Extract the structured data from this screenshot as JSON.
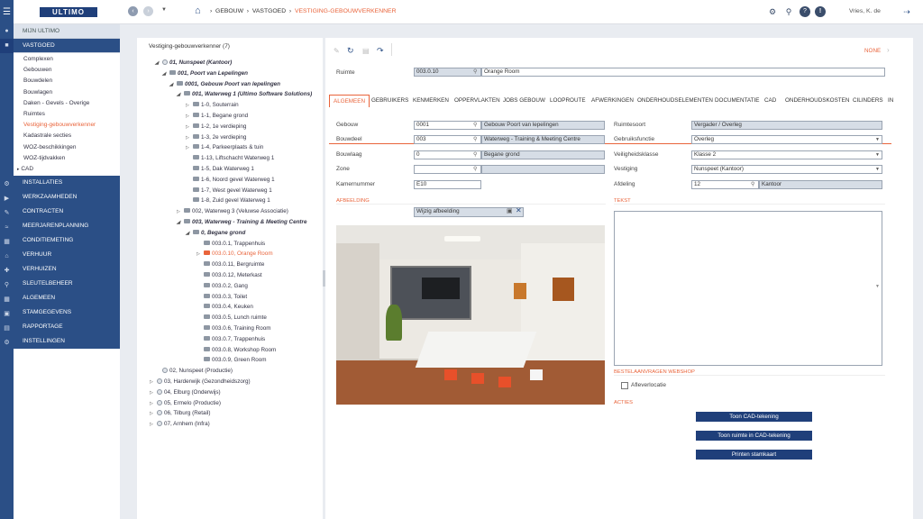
{
  "app": {
    "logo": "ULTIMO",
    "user": "Vries, K. de"
  },
  "breadcrumb": [
    "GEBOUW",
    "VASTGOED",
    "VESTIGING-GEBOUWVERKENNER"
  ],
  "nav": {
    "mijn": "MIJN ULTIMO",
    "vastgoed": "VASTGOED",
    "sub": [
      "Complexen",
      "Gebouwen",
      "Bouwdelen",
      "Bouwlagen",
      "Daken - Gevels - Overige",
      "Ruimtes",
      "Vestiging-gebouwverkenner",
      "Kadastrale secties",
      "WOZ-beschikkingen",
      "WOZ-tijdvakken",
      "CAD"
    ],
    "sections": [
      "INSTALLATIES",
      "WERKZAAMHEDEN",
      "CONTRACTEN",
      "MEERJARENPLANNING",
      "CONDITIEMETING",
      "VERHUUR",
      "VERHUIZEN",
      "SLEUTELBEHEER",
      "ALGEMEEN",
      "STAMGEGEVENS",
      "RAPPORTAGE",
      "INSTELLINGEN"
    ]
  },
  "tree": {
    "title": "Vestiging-gebouwverkenner (7)",
    "rows": [
      "01, Nunspeet (Kantoor)",
      "001, Poort van Lepelingen",
      "0001, Gebouw Poort van lepelingen",
      "001, Waterweg 1 (Ultimo Software Solutions)",
      "1-0, Souterrain",
      "1-1, Begane grond",
      "1-2, 1e verdieping",
      "1-3, 2e verdieping",
      "1-4, Parkeerplaats & tuin",
      "1-13, Liftschacht Waterweg 1",
      "1-5, Dak Waterweg 1",
      "1-6, Noord gevel Waterweg 1",
      "1-7, West gevel Waterweg 1",
      "1-8, Zuid gevel Waterweg 1",
      "002, Waterweg 3 (Veluwse Associatie)",
      "003, Waterweg - Training & Meeting Centre",
      "0, Begane grond",
      "003.0.1, Trappenhuis",
      "003.0.10, Orange Room",
      "003.0.11, Bergruimte",
      "003.0.12, Meterkast",
      "003.0.2, Gang",
      "003.0.3, Toilet",
      "003.0.4, Keuken",
      "003.0.5, Lunch ruimte",
      "003.0.6, Training Room",
      "003.0.7, Trappenhuis",
      "003.0.8, Workshop Room",
      "003.0.9, Green Room",
      "02, Nunspeet (Productie)",
      "03, Harderwijk (Gezondheidszorg)",
      "04, Elburg (Onderwijs)",
      "05, Ermelo (Productie)",
      "06, Tilburg (Retail)",
      "07, Arnhem (Infra)"
    ]
  },
  "toolbar": {
    "none_label": "NONE"
  },
  "ruimte": {
    "label": "Ruimte",
    "code": "003.0.10",
    "name": "Orange Room"
  },
  "tabs": [
    "ALGEMEEN",
    "GEBRUIKERS",
    "KENMERKEN",
    "OPPERVLAKTEN",
    "JOBS GEBOUW",
    "LOOPROUTE",
    "AFWERKINGEN",
    "ONDERHOUDSELEMENTEN",
    "DOCUMENTATIE",
    "CAD",
    "ONDERHOUDSKOSTEN",
    "CILINDERS",
    "IN"
  ],
  "form": {
    "gebouw": {
      "label": "Gebouw",
      "code": "0001",
      "desc": "Gebouw Poort van lepelingen"
    },
    "bouwdeel": {
      "label": "Bouwdeel",
      "code": "003",
      "desc": "Waterweg - Training & Meeting Centre"
    },
    "bouwlaag": {
      "label": "Bouwlaag",
      "code": "0",
      "desc": "Begane grond"
    },
    "zone": {
      "label": "Zone",
      "code": "",
      "desc": ""
    },
    "kamernummer": {
      "label": "Kamernummer",
      "value": "E10"
    },
    "ruimtesoort": {
      "label": "Ruimtesoort",
      "value": "Vergader / Overleg"
    },
    "gebruiksfunctie": {
      "label": "Gebruiksfunctie",
      "value": "Overleg"
    },
    "veiligheidsklasse": {
      "label": "Veiligheidsklasse",
      "value": "Klasse 2"
    },
    "vestiging": {
      "label": "Vestiging",
      "value": "Nunspeet (Kantoor)"
    },
    "afdeling": {
      "label": "Afdeling",
      "code": "12",
      "desc": "Kantoor"
    }
  },
  "afbeelding": {
    "section": "AFBEELDING",
    "button": "Wijzig afbeelding"
  },
  "tekst": {
    "section": "TEKST"
  },
  "webshop": {
    "section": "BESTELAANVRAGEN WEBSHOP",
    "checkbox": "Afleverlocatie"
  },
  "acties": {
    "section": "ACTIES",
    "buttons": [
      "Toon CAD-tekening",
      "Toon ruimte in CAD-tekening",
      "Printen stamkaart"
    ]
  }
}
